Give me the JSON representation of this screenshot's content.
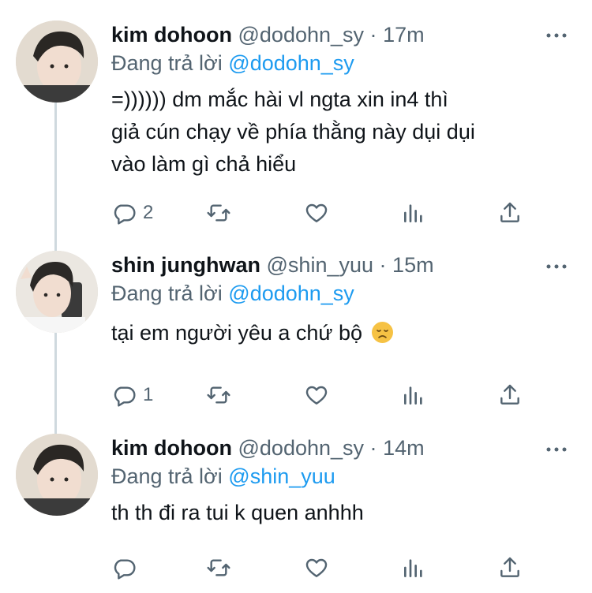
{
  "tweets": [
    {
      "name": "kim dohoon",
      "handle": "@dodohn_sy",
      "dot": "·",
      "time": "17m",
      "reply_prefix": "Đang trả lời",
      "reply_to": "@dodohn_sy",
      "text_lines": [
        "=)))))) dm mắc hài vl ngta xin in4 thì",
        "giả cún chạy về phía thằng này dụi dụi",
        "vào làm gì chả hiểu"
      ],
      "replies": "2",
      "emoji": ""
    },
    {
      "name": "shin junghwan",
      "handle": "@shin_yuu",
      "dot": "·",
      "time": "15m",
      "reply_prefix": "Đang trả lời",
      "reply_to": "@dodohn_sy",
      "text_lines": [
        "tại em người yêu a chứ bộ"
      ],
      "replies": "1",
      "emoji": "disappointed-face"
    },
    {
      "name": "kim dohoon",
      "handle": "@dodohn_sy",
      "dot": "·",
      "time": "14m",
      "reply_prefix": "Đang trả lời",
      "reply_to": "@shin_yuu",
      "text_lines": [
        "th th đi ra tui k quen anhhh"
      ],
      "replies": "",
      "emoji": ""
    }
  ],
  "icons": {
    "reply": "reply-icon",
    "retweet": "retweet-icon",
    "like": "heart-icon",
    "analytics": "analytics-icon",
    "share": "share-icon",
    "more": "more-icon"
  },
  "colors": {
    "text": "#0f1419",
    "secondary": "#536471",
    "accent": "#1d9bf0",
    "thread": "#cfd9de"
  }
}
